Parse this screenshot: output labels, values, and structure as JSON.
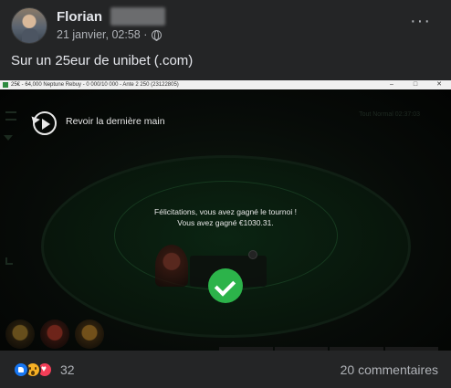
{
  "post": {
    "author_name": "Florian",
    "date": "21 janvier, 02:58 ·",
    "privacy_icon": "globe-icon",
    "more_icon": "···",
    "text": "Sur un 25eur de unibet (.com)"
  },
  "screenshot": {
    "window_title": "25€ - 64,000 Neptune Rebuy - 0 000/10 000 - Ante 2 250 (23122805)",
    "window_controls": [
      "–",
      "□",
      "✕"
    ],
    "replay_label": "Revoir la dernière main",
    "top_right_info": "Tout Normal   02:37:03",
    "message_line1": "Félicitations, vous avez gagné le tournoi !",
    "message_line2": "Vous avez gagné €1030.31."
  },
  "footer": {
    "reaction_count": "32",
    "comments_label": "20 commentaires"
  }
}
